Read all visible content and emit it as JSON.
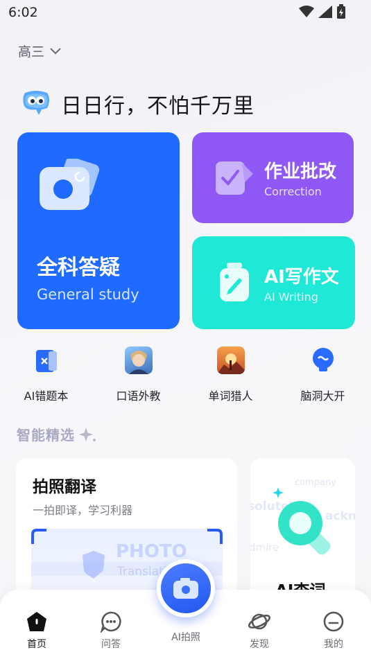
{
  "status": {
    "time": "6:02"
  },
  "grade": {
    "label": "高三"
  },
  "greeting": {
    "text": "日日行，不怕千万里"
  },
  "cards": {
    "general": {
      "title": "全科答疑",
      "subtitle": "General study",
      "color": "#1f6bff"
    },
    "correction": {
      "title": "作业批改",
      "subtitle": "Correction",
      "color": "#8f57f3"
    },
    "writing": {
      "title": "AI写作文",
      "subtitle": "AI Writing",
      "color": "#20e8d6"
    }
  },
  "quick": [
    {
      "label": "AI错题本",
      "icon": "error-book-icon"
    },
    {
      "label": "口语外教",
      "icon": "tutor-avatar-icon"
    },
    {
      "label": "单词猎人",
      "icon": "word-hunter-icon"
    },
    {
      "label": "脑洞大开",
      "icon": "brain-bulb-icon"
    }
  ],
  "section": {
    "title": "智能精选"
  },
  "features": {
    "translate": {
      "title": "拍照翻译",
      "subtitle": "一拍即译，学习利器",
      "bg_word": "PHOTO",
      "bg_word2": "Translati"
    },
    "dict": {
      "title": "AI查词",
      "w1": "company",
      "w2": "solutel",
      "w3": "ackno",
      "w4": "dmire"
    }
  },
  "nav": [
    {
      "label": "首页",
      "icon": "home-icon",
      "active": true
    },
    {
      "label": "问答",
      "icon": "chat-icon",
      "active": false
    },
    {
      "label": "AI拍照",
      "icon": "camera-icon",
      "active": false
    },
    {
      "label": "发现",
      "icon": "planet-icon",
      "active": false
    },
    {
      "label": "我的",
      "icon": "profile-icon",
      "active": false
    }
  ]
}
